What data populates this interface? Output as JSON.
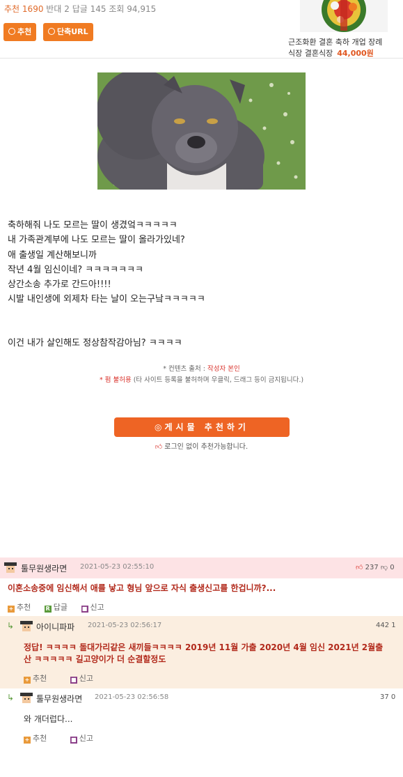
{
  "stats": {
    "rec_label": "추천",
    "rec_count": "1690",
    "opp_label": "반대",
    "opp_count": "2",
    "reply_label": "답글",
    "reply_count": "145",
    "view_label": "조회",
    "view_count": "94,915"
  },
  "buttons": {
    "recommend": "추천",
    "short_url": "단축URL"
  },
  "ad": {
    "line1": "근조화환 결혼 축하 개업 장례",
    "line2": "식장 결혼식장",
    "price": "44,000원"
  },
  "post": {
    "lines": [
      "축하해줘 나도 모르는 딸이 생겼엌ㅋㅋㅋㅋㅋ",
      "내 가족관계부에 나도 모르는 딸이 올라가있네?",
      "애 출생일 계산해보니까",
      "작년 4월 임신이네? ㅋㅋㅋㅋㅋㅋㅋ",
      "상간소송 추가로 간드아!!!!",
      "시발 내인생에 외제차 타는 날이 오는구낰ㅋㅋㅋㅋㅋ"
    ],
    "last_line": "이건 내가 살인해도 정상참작감아님? ㅋㅋㅋㅋ",
    "source_prefix": "* 컨텐츠 출처 : ",
    "source_value": "작성자 본인",
    "no_copy": "* 펌 불허용",
    "no_copy_detail": " (타 사이트 등록을 불허하며 우클릭, 드래그 등이 금지됩니다.)",
    "recommend_button": "게시물 추천하기",
    "recommend_note": "로그인 없이 추천가능합니다."
  },
  "comments": [
    {
      "name": "툴무원생라면",
      "date": "2021-05-23 02:55:10",
      "up": "237",
      "down": "0",
      "text": "이혼소송중에 임신해서 애를 낳고 형님 앞으로 자식 출생신고를 한겁니까?...",
      "actions": [
        "추천",
        "답글",
        "신고"
      ]
    },
    {
      "name": "아이니파파",
      "date": "2021-05-23 02:56:17",
      "up": "442",
      "down": "1",
      "text_line1": "정답! ㅋㅋㅋㅋ 돌대가리같은 새끼들ㅋㅋㅋㅋ 2019년 11월 가출 2020년 4월 임신 2021년 2월출",
      "text_line2": "산 ㅋㅋㅋㅋㅋ 길고양이가 더 순결할정도",
      "actions": [
        "추천",
        "신고"
      ]
    },
    {
      "name": "툴무원생라면",
      "date": "2021-05-23 02:56:58",
      "up": "37",
      "down": "0",
      "text": "와 개더럽다...",
      "actions": [
        "추천",
        "신고"
      ]
    }
  ],
  "colors": {
    "accent": "#f07b22",
    "comment_highlight": "#fde3e5",
    "reply_bg": "#fbeee0",
    "comment_text": "#b22a1c"
  }
}
